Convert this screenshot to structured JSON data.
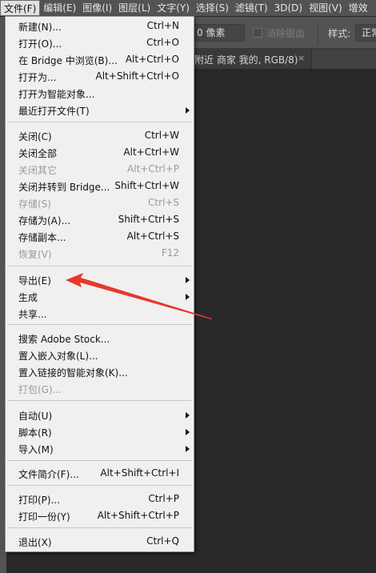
{
  "menubar": {
    "items": [
      "文件(F)",
      "编辑(E)",
      "图像(I)",
      "图层(L)",
      "文字(Y)",
      "选择(S)",
      "滤镜(T)",
      "3D(D)",
      "视图(V)",
      "增效"
    ]
  },
  "options": {
    "feather_value": "0 像素",
    "antialias_label": "消除锯齿",
    "style_label": "样式:",
    "style_value": "正常"
  },
  "tab": {
    "title": "附近 商家 我的, RGB/8)",
    "close": "×"
  },
  "file_menu": {
    "items": [
      {
        "label": "新建(N)...",
        "shortcut": "Ctrl+N"
      },
      {
        "label": "打开(O)...",
        "shortcut": "Ctrl+O"
      },
      {
        "label": "在 Bridge 中浏览(B)...",
        "shortcut": "Alt+Ctrl+O"
      },
      {
        "label": "打开为...",
        "shortcut": "Alt+Shift+Ctrl+O"
      },
      {
        "label": "打开为智能对象...",
        "shortcut": ""
      },
      {
        "label": "最近打开文件(T)",
        "shortcut": ""
      },
      {
        "label": "关闭(C)",
        "shortcut": "Ctrl+W"
      },
      {
        "label": "关闭全部",
        "shortcut": "Alt+Ctrl+W"
      },
      {
        "label": "关闭其它",
        "shortcut": "Alt+Ctrl+P"
      },
      {
        "label": "关闭并转到 Bridge...",
        "shortcut": "Shift+Ctrl+W"
      },
      {
        "label": "存储(S)",
        "shortcut": "Ctrl+S"
      },
      {
        "label": "存储为(A)...",
        "shortcut": "Shift+Ctrl+S"
      },
      {
        "label": "存储副本...",
        "shortcut": "Alt+Ctrl+S"
      },
      {
        "label": "恢复(V)",
        "shortcut": "F12"
      },
      {
        "label": "导出(E)",
        "shortcut": ""
      },
      {
        "label": "生成",
        "shortcut": ""
      },
      {
        "label": "共享...",
        "shortcut": ""
      },
      {
        "label": "搜索 Adobe Stock...",
        "shortcut": ""
      },
      {
        "label": "置入嵌入对象(L)...",
        "shortcut": ""
      },
      {
        "label": "置入链接的智能对象(K)...",
        "shortcut": ""
      },
      {
        "label": "打包(G)...",
        "shortcut": ""
      },
      {
        "label": "自动(U)",
        "shortcut": ""
      },
      {
        "label": "脚本(R)",
        "shortcut": ""
      },
      {
        "label": "导入(M)",
        "shortcut": ""
      },
      {
        "label": "文件简介(F)...",
        "shortcut": "Alt+Shift+Ctrl+I"
      },
      {
        "label": "打印(P)...",
        "shortcut": "Ctrl+P"
      },
      {
        "label": "打印一份(Y)",
        "shortcut": "Alt+Shift+Ctrl+P"
      },
      {
        "label": "退出(X)",
        "shortcut": "Ctrl+Q"
      }
    ]
  },
  "colors": {
    "annotation_arrow": "#e8382c"
  }
}
